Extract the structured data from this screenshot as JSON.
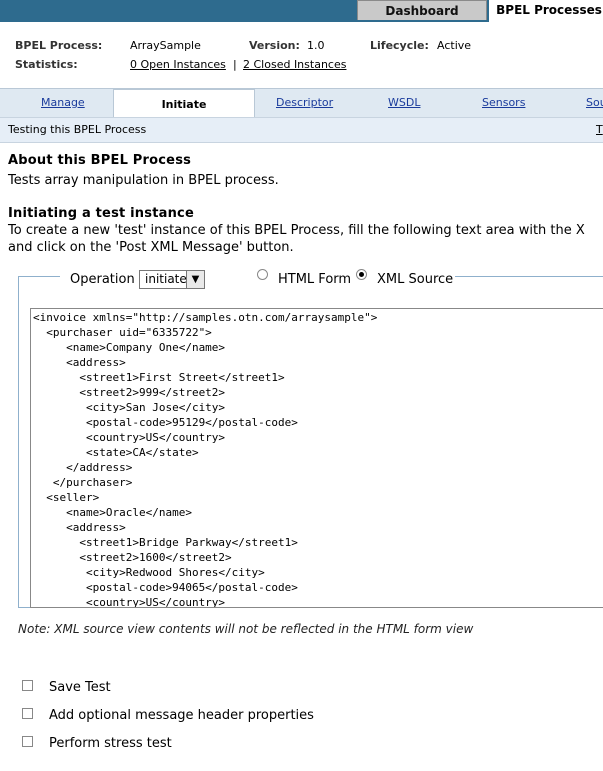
{
  "topbar": {
    "tab_dashboard": "Dashboard",
    "tab_bpel": "BPEL Processes"
  },
  "info": {
    "process_label": "BPEL Process:",
    "process_value": "ArraySample",
    "version_label": "Version:",
    "version_value": "1.0",
    "lifecycle_label": "Lifecycle:",
    "lifecycle_value": "Active",
    "stats_label": "Statistics:",
    "open_instances": "0 Open Instances",
    "separator": "|",
    "closed_instances": "2 Closed Instances"
  },
  "nav": {
    "tabs": [
      "Manage",
      "Initiate",
      "Descriptor",
      "WSDL",
      "Sensors",
      "Sou"
    ],
    "active": "Initiate"
  },
  "subbar": {
    "text": "Testing this BPEL Process",
    "right": "T"
  },
  "about": {
    "title": "About this BPEL Process",
    "desc": "Tests array manipulation in BPEL process."
  },
  "initiate": {
    "title": "Initiating a test instance",
    "line1": "To create a new 'test' instance of this BPEL Process, fill the following text area with the X",
    "line2": "and click on the 'Post XML Message' button."
  },
  "form": {
    "operation_label": "Operation",
    "operation_value": "initiate",
    "html_form_label": "HTML Form",
    "xml_source_label": "XML Source",
    "selected_view": "XML Source"
  },
  "xml_source": "<invoice xmlns=\"http://samples.otn.com/arraysample\">\n  <purchaser uid=\"6335722\">\n     <name>Company One</name>\n     <address>\n       <street1>First Street</street1>\n       <street2>999</street2>\n        <city>San Jose</city>\n        <postal-code>95129</postal-code>\n        <country>US</country>\n        <state>CA</state>\n     </address>\n   </purchaser>\n  <seller>\n     <name>Oracle</name>\n     <address>\n       <street1>Bridge Parkway</street1>\n       <street2>1600</street2>\n        <city>Redwood Shores</city>\n        <postal-code>94065</postal-code>\n        <country>US</country>",
  "note": "Note: XML source view contents will not be reflected in the HTML form view",
  "options": {
    "save_test": "Save Test",
    "header_props": "Add optional message header properties",
    "stress_test": "Perform stress test"
  }
}
